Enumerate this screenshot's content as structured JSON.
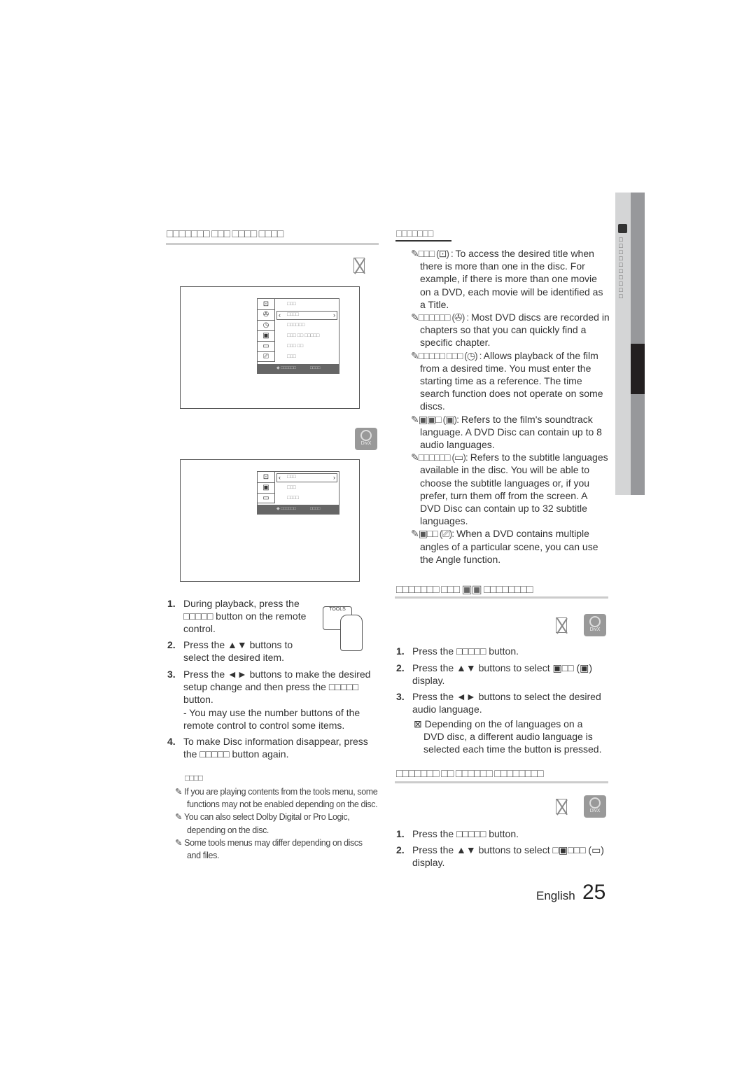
{
  "left": {
    "heading": "□□□□□□□ □□□ □□□□ □□□□",
    "osd1": {
      "items": [
        "□□□",
        "□□□□",
        "□□□□□□",
        "□□□ □□ □□□□□",
        "□□□ □□",
        "□□□"
      ],
      "footer_move": "◆ □□□□□□",
      "footer_enter": "□□□□"
    },
    "osd2": {
      "items": [
        "□□□",
        "□□□",
        "□□□□"
      ],
      "footer_move": "◆ □□□□□□",
      "footer_enter": "□□□□"
    },
    "steps": [
      {
        "num": "1.",
        "text": "During playback, press the □□□□□ button on the remote control."
      },
      {
        "num": "2.",
        "text": "Press the ▲▼ buttons to select the desired item."
      },
      {
        "num": "3.",
        "text": "Press the ◄► buttons to make the desired setup change and then press the □□□□□ button."
      },
      {
        "num": "4.",
        "text": "To make Disc information disappear, press the □□□□□ button again."
      }
    ],
    "step3_sub": "- You may use the number buttons of the remote control to control some items.",
    "tools_label": "TOOLS",
    "note_heading": "□□□□",
    "notes": [
      "If you are playing contents from the tools menu, some functions may not be enabled depending on the disc.",
      "You can also select Dolby Digital or Pro Logic, depending on the disc.",
      "Some tools menus may differ depending on discs and files."
    ]
  },
  "right": {
    "heading": "□□□□□□□",
    "defs": [
      {
        "term": "✎□□□ (⊡) :",
        "text": "To access the desired title when there is more than one in the disc. For example, if there is more than one movie on a DVD, each movie will be identified as a Title."
      },
      {
        "term": "✎□□□□□□ (✇) :",
        "text": "Most DVD discs are recorded in chapters so that you can quickly find a specific chapter."
      },
      {
        "term": "✎□□□□□ □□□ (◷) :",
        "text": "Allows playback of the film from a desired time. You must enter the starting time as a reference. The time search function does not operate on some discs."
      },
      {
        "term": "✎▣▣□ (▣):",
        "text": "Refers to the film's soundtrack language. A DVD Disc can contain up to 8 audio languages."
      },
      {
        "term": "✎□□□□□□ (▭):",
        "text": "Refers to the subtitle languages available in the disc. You will be able to choose the subtitle languages or, if you prefer, turn them off from the screen. A DVD Disc can contain up to 32 subtitle languages."
      },
      {
        "term": "✎▣□□ (⎚):",
        "text": "When a DVD contains multiple angles of a particular scene, you can use the Angle function."
      }
    ],
    "sec2_heading": "□□□□□□□ □□□ ▣▣ □□□□□□□□",
    "sec2_steps": [
      {
        "num": "1.",
        "text": "Press the □□□□□ button."
      },
      {
        "num": "2.",
        "text": "Press the ▲▼ buttons to select ▣□□ (▣) display."
      },
      {
        "num": "3.",
        "text": "Press the ◄► buttons to select the desired audio language."
      }
    ],
    "sec2_note": "⊠ Depending on the of languages on a DVD disc, a different audio language is selected each time the button is pressed.",
    "sec3_heading": "□□□□□□□ □□ □□□□□□ □□□□□□□□",
    "sec3_steps": [
      {
        "num": "1.",
        "text": "Press the □□□□□ button."
      },
      {
        "num": "2.",
        "text": "Press the ▲▼ buttons to select □▣□□□ (▭) display."
      }
    ],
    "divx_label": "DivX"
  },
  "footer": {
    "language": "English",
    "page_number": "25"
  },
  "side_tab": {
    "label": "□□□□□□□□□□"
  }
}
